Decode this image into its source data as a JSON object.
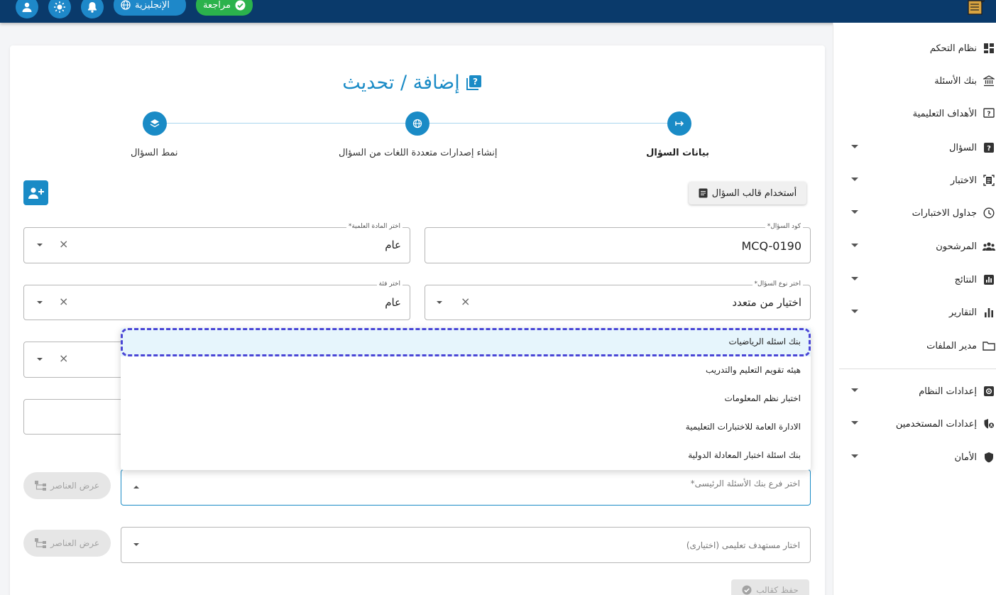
{
  "topbar": {
    "language_label": "الإنجليزية",
    "review_label": "مراجعة",
    "icons": [
      "user-icon",
      "brightness-icon",
      "bell-icon",
      "globe-icon",
      "check-circle-icon",
      "app-logo"
    ]
  },
  "sidebar": {
    "items": [
      {
        "label": "نظام التحكم",
        "icon": "dashboard-icon",
        "has_caret": false
      },
      {
        "label": "بنك الأسئلة",
        "icon": "bank-icon",
        "has_caret": false
      },
      {
        "label": "الأهداف التعليمية",
        "icon": "question-box-icon",
        "has_caret": false
      },
      {
        "label": "السؤال",
        "icon": "question-icon",
        "has_caret": true
      },
      {
        "label": "الاختبار",
        "icon": "exam-icon",
        "has_caret": true
      },
      {
        "label": "جداول الاختبارات",
        "icon": "clock-icon",
        "has_caret": true
      },
      {
        "label": "المرشحون",
        "icon": "people-icon",
        "has_caret": true
      },
      {
        "label": "النتائج",
        "icon": "results-icon",
        "has_caret": true
      },
      {
        "label": "التقارير",
        "icon": "bar-chart-icon",
        "has_caret": true
      },
      {
        "label": "مدير الملفات",
        "icon": "folder-icon",
        "has_caret": false
      },
      {
        "label": "إعدادات النظام",
        "icon": "settings-icon",
        "has_caret": true
      },
      {
        "label": "إعدادات المستخدمين",
        "icon": "user-shield-icon",
        "has_caret": true
      },
      {
        "label": "الأمان",
        "icon": "shield-icon",
        "has_caret": true
      }
    ]
  },
  "page": {
    "title": "إضافة / تحديث",
    "title_icon": "question-box-icon"
  },
  "stepper": {
    "steps": [
      {
        "label": "بيانات السؤال",
        "active": true,
        "icon": "arrow-right-icon"
      },
      {
        "label": "إنشاء إصدارات متعددة اللغات من السؤال",
        "active": false,
        "icon": "globe-icon"
      },
      {
        "label": "نمط السؤال",
        "active": false,
        "icon": "layers-icon"
      }
    ]
  },
  "toolbar": {
    "template_button_label": "أستخدام قالب السؤال",
    "add_user_icon": "add-user-icon"
  },
  "form": {
    "question_code": {
      "label": "كود السؤال*",
      "value": "MCQ-0190"
    },
    "subject": {
      "label": "اختر المادة العلمية*",
      "value": "عام"
    },
    "question_type": {
      "label": "اختر نوع السؤال*",
      "value": "اختيار من متعدد"
    },
    "category": {
      "label": "اختر فئة",
      "value": "عام"
    },
    "bank_branch": {
      "placeholder": "اختر فرع بنك الأسئلة الرئيسى*"
    },
    "learning_target": {
      "placeholder": "اختار مستهدف تعليمى (اختيارى)"
    }
  },
  "dropdown": {
    "options": [
      "بنك اسئله الرياضيات",
      "هيئه تقويم التعليم والتدريب",
      "اختبار نظم المعلومات",
      "الادارة العامة للاختبارات التعليمية",
      "بنك اسئلة اختبار المعادلة الدولية"
    ],
    "selected_index": 0
  },
  "buttons": {
    "view_elements_label": "عرض العناصر",
    "save_label": "حفظ كقالب"
  },
  "colors": {
    "topbar": "#0a3a6b",
    "accent": "#1a8bc6",
    "review": "#2bb24c",
    "highlight_border": "#4a46d6"
  }
}
